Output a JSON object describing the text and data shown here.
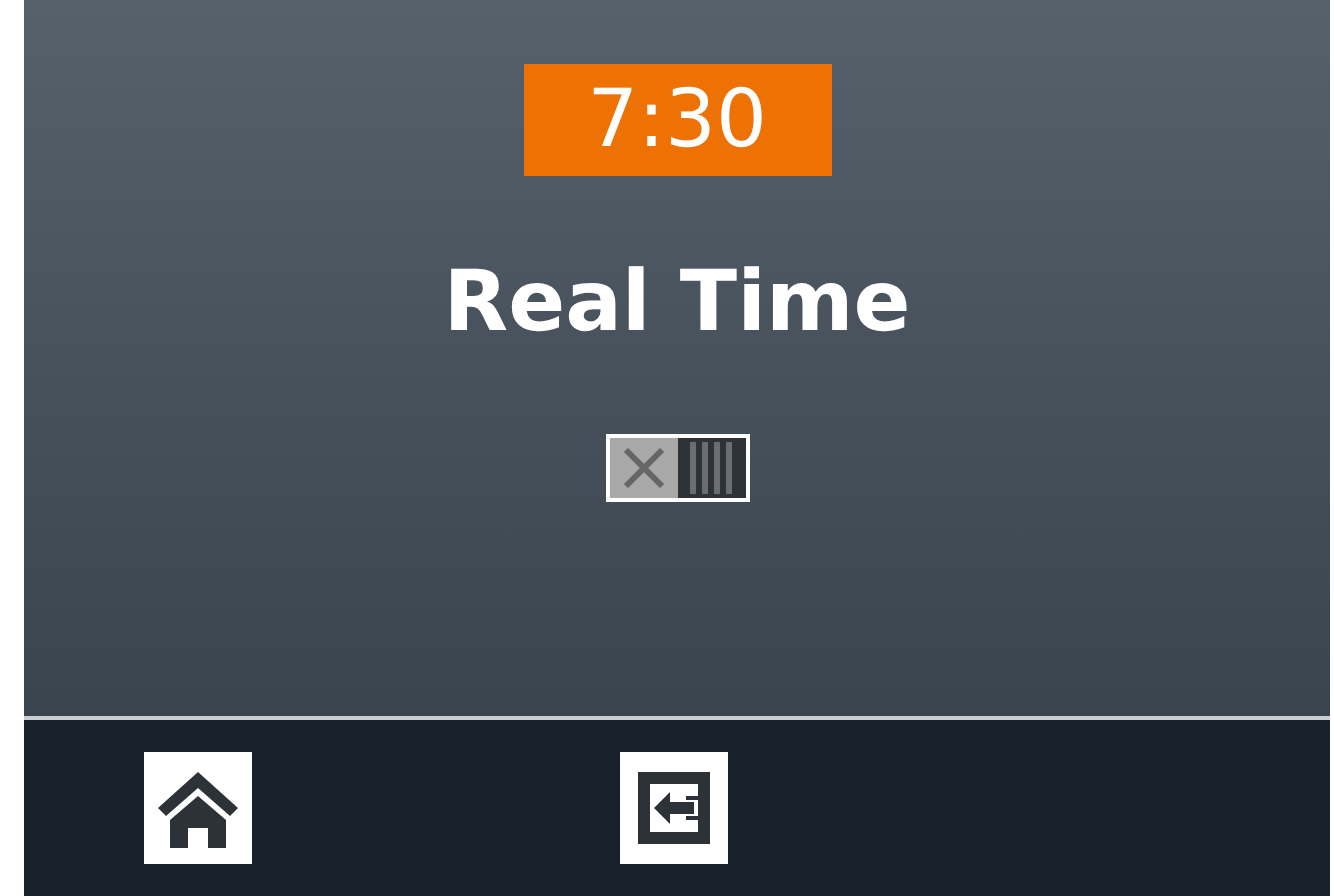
{
  "clock": "7:30",
  "title": "Real Time",
  "toggle": {
    "on": false
  }
}
